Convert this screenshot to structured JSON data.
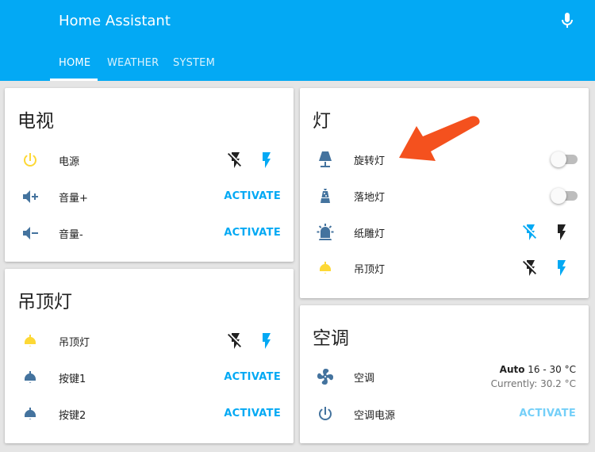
{
  "header": {
    "title": "Home Assistant",
    "tabs": [
      {
        "label": "HOME"
      },
      {
        "label": "WEATHER"
      },
      {
        "label": "SYSTEM"
      }
    ]
  },
  "cards": {
    "tv": {
      "title": "电视",
      "rows": [
        {
          "name": "电源",
          "icon": "power-icon"
        },
        {
          "name": "音量+",
          "icon": "volume-plus-icon",
          "action": "ACTIVATE"
        },
        {
          "name": "音量-",
          "icon": "volume-minus-icon",
          "action": "ACTIVATE"
        }
      ]
    },
    "ceiling": {
      "title": "吊顶灯",
      "rows": [
        {
          "name": "吊顶灯",
          "icon": "ceiling-light-icon"
        },
        {
          "name": "按键1",
          "icon": "bell-icon",
          "action": "ACTIVATE"
        },
        {
          "name": "按键2",
          "icon": "bell-icon",
          "action": "ACTIVATE"
        }
      ]
    },
    "lights": {
      "title": "灯",
      "rows": [
        {
          "name": "旋转灯",
          "icon": "lamp-icon",
          "state": "off"
        },
        {
          "name": "落地灯",
          "icon": "lava-lamp-icon",
          "state": "off"
        },
        {
          "name": "纸雕灯",
          "icon": "alarm-light-icon"
        },
        {
          "name": "吊顶灯",
          "icon": "ceiling-light-icon"
        }
      ]
    },
    "ac": {
      "title": "空调",
      "rows": [
        {
          "name": "空调",
          "icon": "air-conditioner-icon",
          "mode": "Auto",
          "range": "16 - 30 °C",
          "current": "Currently: 30.2 °C"
        },
        {
          "name": "空调电源",
          "icon": "power-icon",
          "action": "ACTIVATE"
        }
      ]
    }
  },
  "colors": {
    "primary": "#03a9f4",
    "icon_blue": "#44739e",
    "icon_yellow": "#fdd835",
    "annotation_red": "#f4511e"
  }
}
